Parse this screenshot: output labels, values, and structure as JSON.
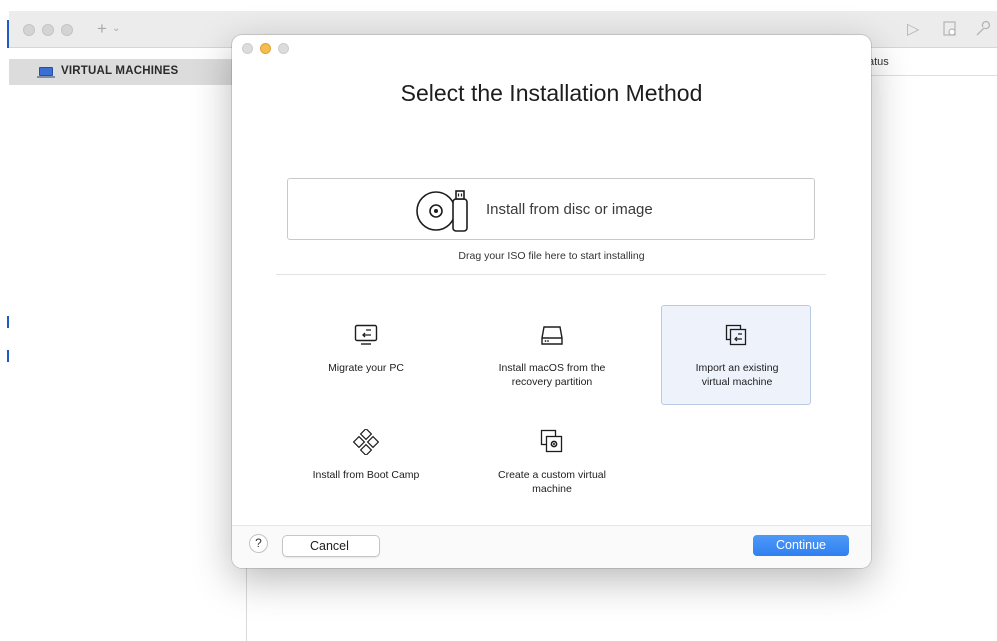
{
  "app": {
    "sidebar_header": "VIRTUAL MACHINES",
    "column_status": "atus"
  },
  "dialog": {
    "title": "Select the Installation Method",
    "disc": {
      "label": "Install from disc or image",
      "hint": "Drag your ISO file here to start installing"
    },
    "options": [
      {
        "label": "Migrate your PC",
        "icon": "migrate-pc-icon"
      },
      {
        "label": "Install macOS from the recovery partition",
        "icon": "hard-drive-icon"
      },
      {
        "label": "Import an existing virtual machine",
        "icon": "import-vm-icon",
        "selected": true
      },
      {
        "label": "Install from Boot Camp",
        "icon": "boot-camp-icon"
      },
      {
        "label": "Create a custom virtual machine",
        "icon": "custom-vm-icon"
      }
    ],
    "footer": {
      "help": "?",
      "cancel": "Cancel",
      "continue": "Continue"
    }
  },
  "colors": {
    "accent": "#2f7ff1",
    "selected_bg": "#eef3fb",
    "traffic_yellow": "#f5bd4f"
  }
}
